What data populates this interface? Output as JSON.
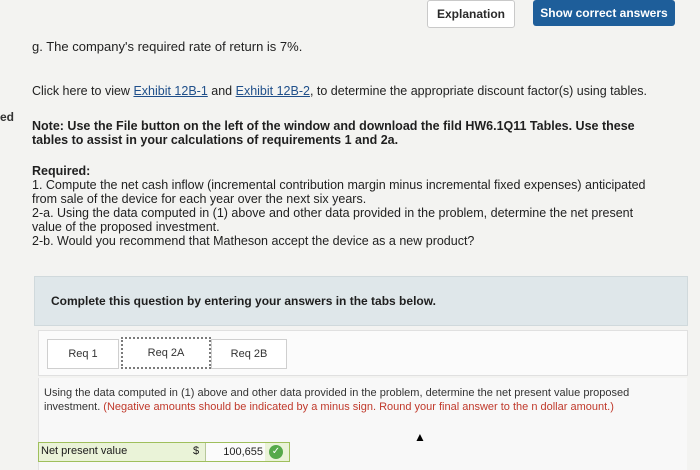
{
  "top_buttons": {
    "explanation": "Explanation",
    "show_correct": "Show correct answers"
  },
  "edge_fragment": "ed",
  "line_g": "g. The company's required rate of return is 7%.",
  "intro": {
    "before": "Click here to view ",
    "exhibit1": "Exhibit 12B-1",
    "and": " and ",
    "exhibit2": "Exhibit 12B-2",
    "after": ", to determine the appropriate discount factor(s) using tables."
  },
  "note": {
    "label": "Note:",
    "text": " Use the File button on the left of the window and download the fild HW6.1Q11 Tables. Use these tables to assist in your calculations of requirements 1 and 2a."
  },
  "required": {
    "label": "Required:",
    "items": [
      "1. Compute the net cash inflow (incremental contribution margin minus incremental fixed expenses) anticipated from sale of the device for each year over the next six years.",
      "2-a. Using the data computed in (1) above and other data provided in the problem, determine the net present value of the proposed investment.",
      "2-b. Would you recommend that Matheson accept the device as a new product?"
    ]
  },
  "panel_title": "Complete this question by entering your answers in the tabs below.",
  "tabs": [
    "Req 1",
    "Req 2A",
    "Req 2B"
  ],
  "instructions": {
    "main": "Using the data computed in (1) above and other data provided in the problem, determine the net present value proposed investment.",
    "red": " (Negative amounts should be indicated by a minus sign. Round your final answer to the n dollar amount.)"
  },
  "answer": {
    "label": "Net present value",
    "currency": "$",
    "value": "100,655"
  }
}
